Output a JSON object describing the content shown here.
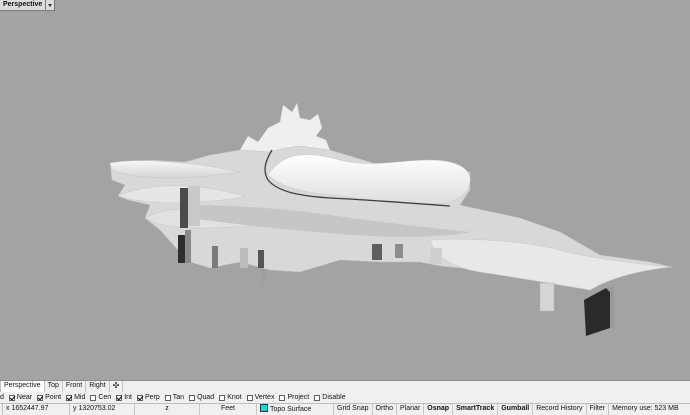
{
  "viewport": {
    "title": "Perspective"
  },
  "view_tabs": [
    "Perspective",
    "Top",
    "Front",
    "Right"
  ],
  "view_tab_add": "✣",
  "osnaps": [
    {
      "label": "d",
      "checked": null
    },
    {
      "label": "Near",
      "checked": true
    },
    {
      "label": "Point",
      "checked": true
    },
    {
      "label": "Mid",
      "checked": true
    },
    {
      "label": "Cen",
      "checked": false
    },
    {
      "label": "Int",
      "checked": true
    },
    {
      "label": "Perp",
      "checked": true
    },
    {
      "label": "Tan",
      "checked": false
    },
    {
      "label": "Quad",
      "checked": false
    },
    {
      "label": "Knot",
      "checked": false
    },
    {
      "label": "Vertex",
      "checked": false
    },
    {
      "label": "Project",
      "checked": false
    },
    {
      "label": "Disable",
      "checked": false
    }
  ],
  "status": {
    "x": "x 1652447.97",
    "y": "y 1320753.02",
    "z": "z",
    "units": "Feet",
    "layer": "Topo Surface",
    "layer_color": "#00e0e0",
    "grid_snap": "Grid Snap",
    "ortho": "Ortho",
    "planar": "Planar",
    "osnap": "Osnap",
    "smarttrack": "SmartTrack",
    "gumball": "Gumball",
    "record_history": "Record History",
    "filter": "Filter",
    "memory": "Memory use: 523 MB"
  }
}
